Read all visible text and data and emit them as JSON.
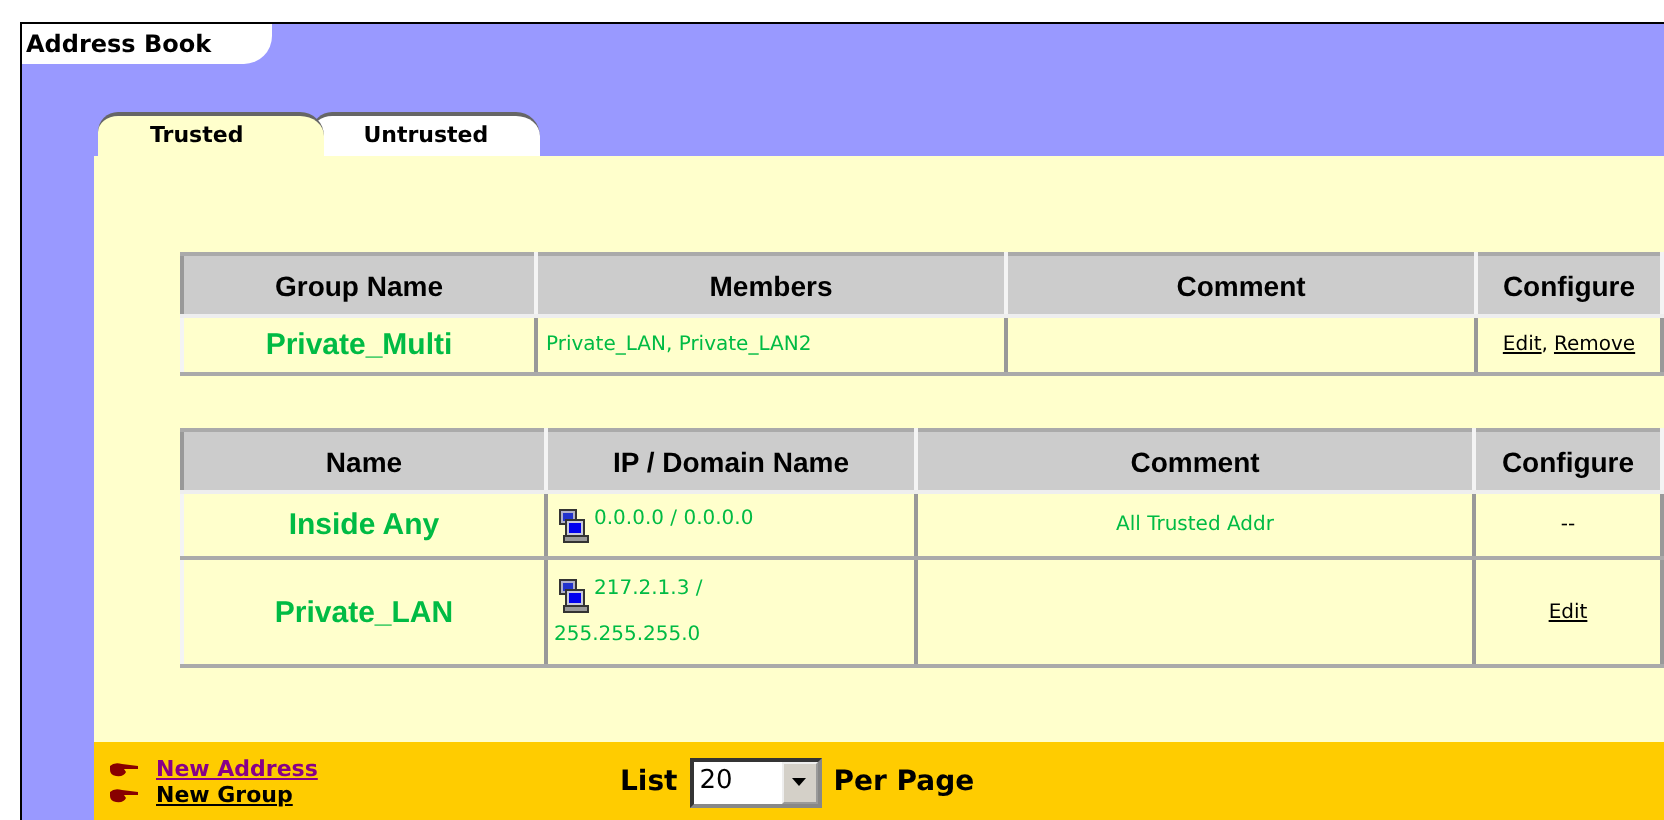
{
  "window": {
    "title": "Address Book"
  },
  "tabs": [
    {
      "label": "Trusted",
      "selected": true
    },
    {
      "label": "Untrusted",
      "selected": false
    }
  ],
  "group_table": {
    "columns": [
      "Group Name",
      "Members",
      "Comment",
      "Configure"
    ],
    "rows": [
      {
        "name": "Private_Multi",
        "members": "Private_LAN, Private_LAN2",
        "comment": "",
        "actions": [
          "Edit",
          "Remove"
        ],
        "action_separator": ","
      }
    ]
  },
  "address_table": {
    "columns": [
      "Name",
      "IP / Domain Name",
      "Comment",
      "Configure"
    ],
    "rows": [
      {
        "name": "Inside Any",
        "ip_lines": [
          "0.0.0.0 / 0.0.0.0"
        ],
        "comment": "All Trusted Addr",
        "configure": "--",
        "kind": "text"
      },
      {
        "name": "Private_LAN",
        "ip_lines": [
          "217.2.1.3 /",
          "255.255.255.0"
        ],
        "comment": "",
        "configure": "Edit",
        "kind": "link"
      }
    ]
  },
  "footer": {
    "links": [
      {
        "label": "New Address",
        "visited": true
      },
      {
        "label": "New Group",
        "visited": false
      }
    ],
    "list_label": "List",
    "page_size": "20",
    "per_page_label": "Per Page"
  }
}
